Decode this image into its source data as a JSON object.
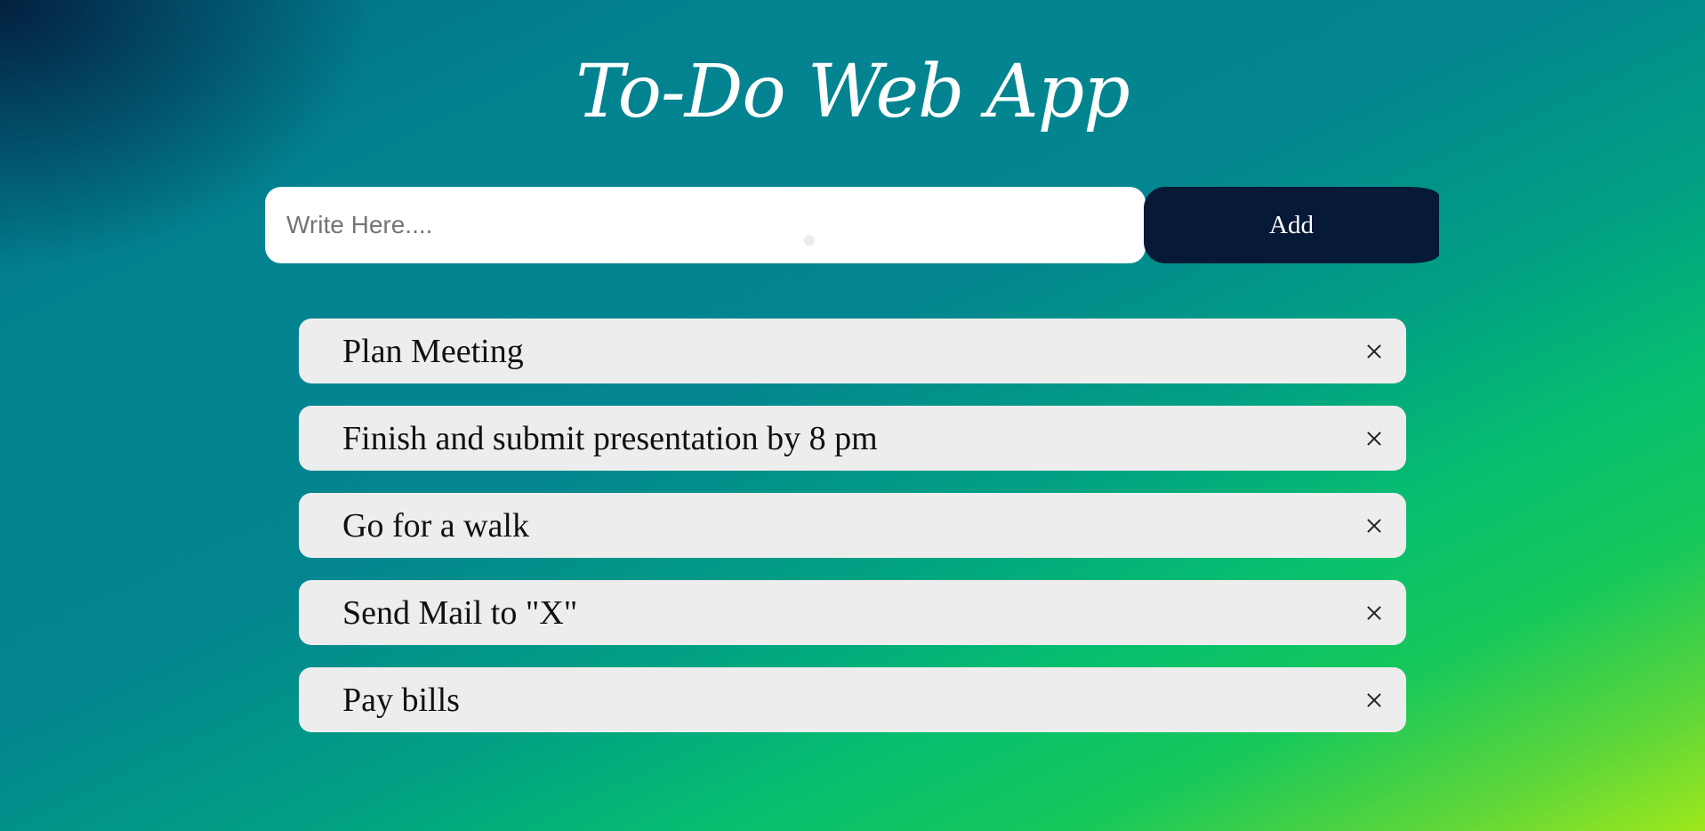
{
  "header": {
    "title": "To-Do Web App"
  },
  "input": {
    "placeholder": "Write Here....",
    "value": ""
  },
  "add_button": {
    "label": "Add"
  },
  "tasks": [
    {
      "text": "Plan Meeting",
      "remove_icon": "close-icon"
    },
    {
      "text": "Finish and submit presentation by 8 pm",
      "remove_icon": "close-icon"
    },
    {
      "text": "Go for a walk",
      "remove_icon": "close-icon"
    },
    {
      "text": "Send Mail to \"X\"",
      "remove_icon": "close-icon"
    },
    {
      "text": "Pay bills",
      "remove_icon": "close-icon"
    }
  ],
  "colors": {
    "background_top": "#006b86",
    "background_bottom": "#9ee81c",
    "corner_dark": "#041c3c",
    "add_button": "#061937",
    "task_item": "#ededed",
    "input_bg": "#ffffff",
    "title_text": "#ffffff"
  }
}
